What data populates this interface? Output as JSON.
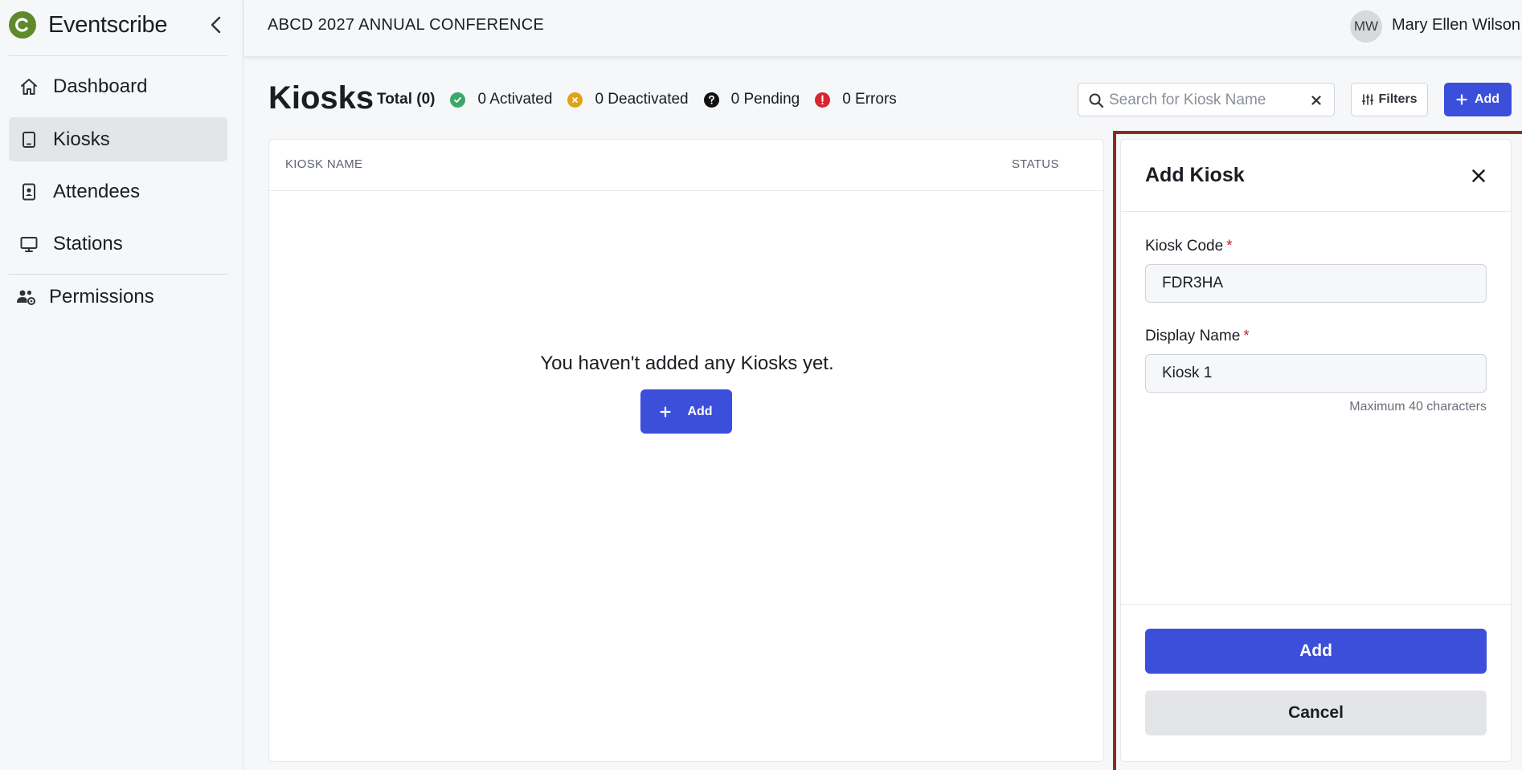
{
  "app": {
    "name": "Eventscribe",
    "logo_letter": "C"
  },
  "sidebar": {
    "items": [
      {
        "label": "Dashboard",
        "icon": "home-icon",
        "active": false
      },
      {
        "label": "Kiosks",
        "icon": "tablet-icon",
        "active": true
      },
      {
        "label": "Attendees",
        "icon": "badge-icon",
        "active": false
      },
      {
        "label": "Stations",
        "icon": "monitor-icon",
        "active": false
      },
      {
        "label": "Permissions",
        "icon": "users-cog-icon",
        "active": false
      }
    ]
  },
  "header": {
    "event_title": "ABCD 2027 ANNUAL CONFERENCE",
    "user": {
      "initials": "MW",
      "name": "Mary Ellen Wilson"
    }
  },
  "page": {
    "title": "Kiosks",
    "stats": {
      "total": "Total (0)",
      "activated": "0 Activated",
      "deactivated": "0 Deactivated",
      "pending": "0 Pending",
      "errors": "0 Errors"
    },
    "search": {
      "placeholder": "Search for Kiosk Name",
      "value": ""
    },
    "filters_label": "Filters",
    "add_label": "Add"
  },
  "table": {
    "columns": [
      "KIOSK NAME",
      "STATUS"
    ],
    "rows": [],
    "empty_message": "You haven't added any Kiosks yet.",
    "empty_add_label": "Add"
  },
  "drawer": {
    "title": "Add Kiosk",
    "fields": {
      "kiosk_code": {
        "label": "Kiosk Code",
        "required_mark": "*",
        "value": "FDR3HA"
      },
      "display_name": {
        "label": "Display Name",
        "required_mark": "*",
        "value": "Kiosk 1",
        "hint": "Maximum 40 characters"
      }
    },
    "primary_label": "Add",
    "secondary_label": "Cancel"
  },
  "colors": {
    "primary": "#3b4fdb",
    "activated": "#3aa867",
    "deactivated": "#e0a21b",
    "pending": "#111111",
    "errors": "#d6262f",
    "highlight_frame": "#8a2b1f",
    "brand": "#5e8a2b"
  }
}
